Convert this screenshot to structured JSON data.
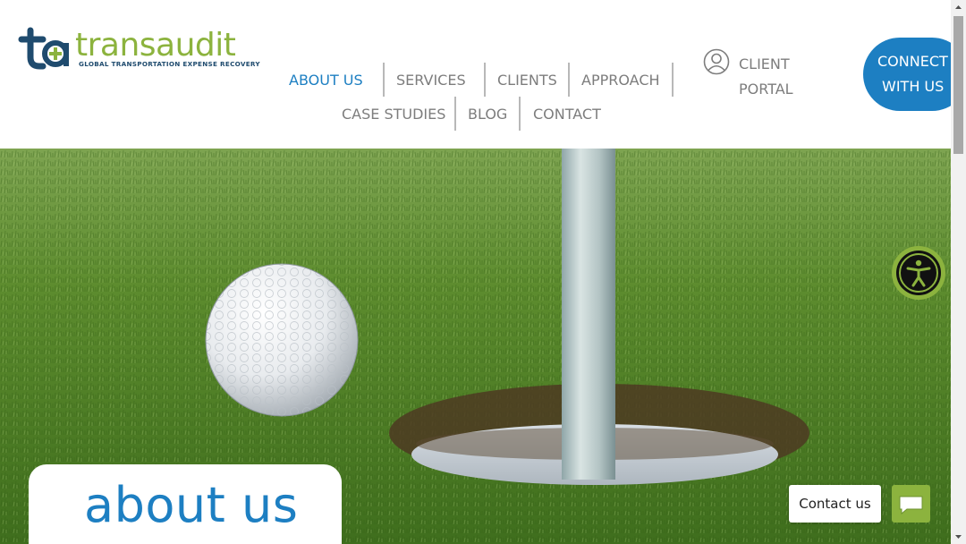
{
  "brand": {
    "name": "transaudit",
    "tagline": "GLOBAL TRANSPORTATION EXPENSE RECOVERY",
    "primary_color": "#1d7fc2",
    "accent_color": "#8cb33e",
    "logo_icon": "ta-logo-mark"
  },
  "nav": {
    "items": [
      {
        "label": "ABOUT US",
        "active": true
      },
      {
        "label": "SERVICES",
        "active": false
      },
      {
        "label": "CLIENTS",
        "active": false
      },
      {
        "label": "APPROACH",
        "active": false
      },
      {
        "label": "CASE STUDIES",
        "active": false
      },
      {
        "label": "BLOG",
        "active": false
      },
      {
        "label": "CONTACT",
        "active": false
      }
    ],
    "portal": {
      "line1": "CLIENT",
      "line2": "PORTAL",
      "icon": "user-circle-icon"
    },
    "cta": {
      "line1": "CONNECT",
      "line2": "WITH US"
    }
  },
  "hero": {
    "image": "golf ball beside hole with flagstick on green",
    "title": "about us"
  },
  "widgets": {
    "accessibility_icon": "accessibility-icon",
    "contact_label": "Contact us",
    "chat_icon": "chat-bubble-icon"
  }
}
